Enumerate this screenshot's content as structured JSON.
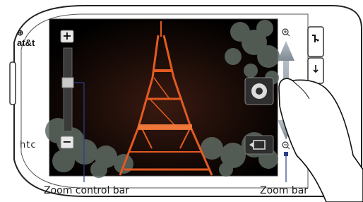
{
  "device": {
    "brand_top": "at&t",
    "brand_bottom": "htc"
  },
  "camera": {
    "zoom_in_symbol": "+",
    "zoom_out_symbol": "−",
    "zoom_level": 0.35
  },
  "callouts": {
    "zoom_control_bar": "Zoom control bar",
    "zoom_bar": "Zoom bar"
  },
  "icons": {
    "shutter": "camera-shutter-icon",
    "mode": "camera-mode-icon",
    "zoom_in": "magnifier-plus-icon",
    "zoom_out": "magnifier-minus-icon",
    "call": "call-icon",
    "back": "back-icon"
  },
  "colors": {
    "callout_line": "#2b3f8c",
    "tower": "#e25a22",
    "arrow": "#9aa3ad"
  }
}
